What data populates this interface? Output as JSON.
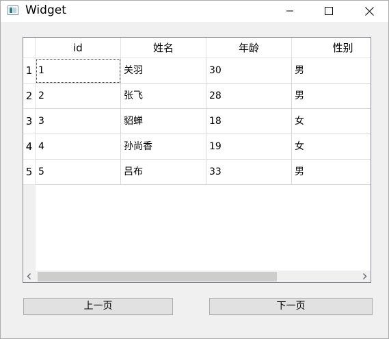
{
  "window": {
    "title": "Widget",
    "icon": "qt-window-icon",
    "controls": {
      "minimize": "minimize-icon",
      "maximize": "maximize-icon",
      "close": "close-icon"
    }
  },
  "table": {
    "columns": [
      "id",
      "姓名",
      "年龄",
      "性别"
    ],
    "row_numbers": [
      "1",
      "2",
      "3",
      "4",
      "5"
    ],
    "rows": [
      [
        "1",
        "关羽",
        "30",
        "男"
      ],
      [
        "2",
        "张飞",
        "28",
        "男"
      ],
      [
        "3",
        "貂蝉",
        "18",
        "女"
      ],
      [
        "4",
        "孙尚香",
        "19",
        "女"
      ],
      [
        "5",
        "吕布",
        "33",
        "男"
      ]
    ]
  },
  "buttons": {
    "prev_label": "上一页",
    "next_label": "下一页"
  }
}
